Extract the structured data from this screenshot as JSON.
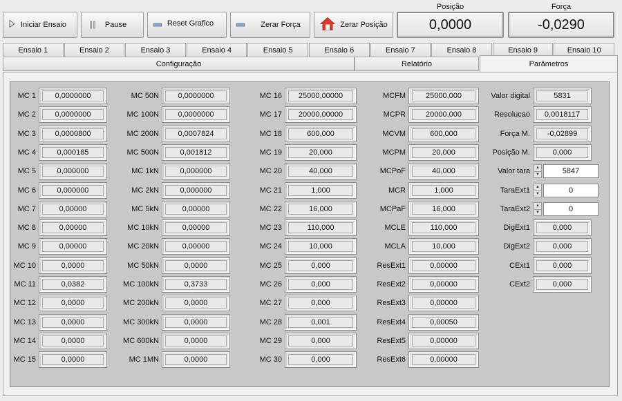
{
  "toolbar": {
    "iniciar_label": "Iniciar Ensaio",
    "pause_label": "Pause",
    "reset_label": "Reset Grafico",
    "zerar_forca_label": "Zerar Força",
    "zerar_posicao_label": "Zerar Posição"
  },
  "readouts": {
    "posicao_label": "Posição",
    "posicao_value": "0,0000",
    "forca_label": "Força",
    "forca_value": "-0,0290"
  },
  "ensaio_tabs": [
    "Ensaio 1",
    "Ensaio 2",
    "Ensaio 3",
    "Ensaio 4",
    "Ensaio 5",
    "Ensaio 6",
    "Ensaio 7",
    "Ensaio 8",
    "Ensaio 9",
    "Ensaio 10"
  ],
  "section_tabs": [
    "Configuração",
    "Relatório",
    "Parâmetros"
  ],
  "columns": {
    "col1": [
      {
        "label": "MC 1",
        "value": "0,0000000"
      },
      {
        "label": "MC 2",
        "value": "0,0000000"
      },
      {
        "label": "MC 3",
        "value": "0,0000800"
      },
      {
        "label": "MC 4",
        "value": "0,000185"
      },
      {
        "label": "MC 5",
        "value": "0,000000"
      },
      {
        "label": "MC 6",
        "value": "0,000000"
      },
      {
        "label": "MC 7",
        "value": "0,00000"
      },
      {
        "label": "MC 8",
        "value": "0,00000"
      },
      {
        "label": "MC 9",
        "value": "0,00000"
      },
      {
        "label": "MC 10",
        "value": "0,0000"
      },
      {
        "label": "MC 11",
        "value": "0,0382"
      },
      {
        "label": "MC 12",
        "value": "0,0000"
      },
      {
        "label": "MC 13",
        "value": "0,0000"
      },
      {
        "label": "MC 14",
        "value": "0,0000"
      },
      {
        "label": "MC 15",
        "value": "0,0000"
      }
    ],
    "col2": [
      {
        "label": "MC 50N",
        "value": "0,0000000"
      },
      {
        "label": "MC 100N",
        "value": "0,0000000"
      },
      {
        "label": "MC 200N",
        "value": "0,0007824"
      },
      {
        "label": "MC 500N",
        "value": "0,001812"
      },
      {
        "label": "MC 1kN",
        "value": "0,000000"
      },
      {
        "label": "MC 2kN",
        "value": "0,000000"
      },
      {
        "label": "MC 5kN",
        "value": "0,00000"
      },
      {
        "label": "MC 10kN",
        "value": "0,00000"
      },
      {
        "label": "MC 20kN",
        "value": "0,00000"
      },
      {
        "label": "MC 50kN",
        "value": "0,0000"
      },
      {
        "label": "MC 100kN",
        "value": "0,3733"
      },
      {
        "label": "MC 200kN",
        "value": "0,0000"
      },
      {
        "label": "MC 300kN",
        "value": "0,0000"
      },
      {
        "label": "MC 600kN",
        "value": "0,0000"
      },
      {
        "label": "MC 1MN",
        "value": "0,0000"
      }
    ],
    "col3": [
      {
        "label": "MC 16",
        "value": "25000,00000"
      },
      {
        "label": "MC 17",
        "value": "20000,00000"
      },
      {
        "label": "MC 18",
        "value": "600,000"
      },
      {
        "label": "MC 19",
        "value": "20,000"
      },
      {
        "label": "MC 20",
        "value": "40,000"
      },
      {
        "label": "MC 21",
        "value": "1,000"
      },
      {
        "label": "MC 22",
        "value": "16,000"
      },
      {
        "label": "MC 23",
        "value": "110,000"
      },
      {
        "label": "MC 24",
        "value": "10,000"
      },
      {
        "label": "MC 25",
        "value": "0,000"
      },
      {
        "label": "MC 26",
        "value": "0,000"
      },
      {
        "label": "MC 27",
        "value": "0,000"
      },
      {
        "label": "MC 28",
        "value": "0,001"
      },
      {
        "label": "MC 29",
        "value": "0,000"
      },
      {
        "label": "MC 30",
        "value": "0,000"
      }
    ],
    "col4": [
      {
        "label": "MCFM",
        "value": "25000,000"
      },
      {
        "label": "MCPR",
        "value": "20000,000"
      },
      {
        "label": "MCVM",
        "value": "600,000"
      },
      {
        "label": "MCPM",
        "value": "20,000"
      },
      {
        "label": "MCPoF",
        "value": "40,000"
      },
      {
        "label": "MCR",
        "value": "1,000"
      },
      {
        "label": "MCPaF",
        "value": "16,000"
      },
      {
        "label": "MCLE",
        "value": "110,000"
      },
      {
        "label": "MCLA",
        "value": "10,000"
      },
      {
        "label": "ResExt1",
        "value": "0,00000"
      },
      {
        "label": "ResExt2",
        "value": "0,00000"
      },
      {
        "label": "ResExt3",
        "value": "0,00000"
      },
      {
        "label": "ResExt4",
        "value": "0,00050"
      },
      {
        "label": "ResExt5",
        "value": "0,00000"
      },
      {
        "label": "ResExt6",
        "value": "0,00000"
      }
    ],
    "col5": [
      {
        "label": "Valor digital",
        "value": "5831",
        "kind": "ro"
      },
      {
        "label": "Resolucao",
        "value": "0,0018117",
        "kind": "ro"
      },
      {
        "label": "Força M.",
        "value": "-0,02899",
        "kind": "ro"
      },
      {
        "label": "Posição M.",
        "value": "0,000",
        "kind": "ro"
      },
      {
        "label": "Valor tara",
        "value": "5847",
        "kind": "spin"
      },
      {
        "label": "TaraExt1",
        "value": "0",
        "kind": "spin"
      },
      {
        "label": "TaraExt2",
        "value": "0",
        "kind": "spin"
      },
      {
        "label": "DigExt1",
        "value": "0,000",
        "kind": "ro"
      },
      {
        "label": "DigExt2",
        "value": "0,000",
        "kind": "ro"
      },
      {
        "label": "CExt1",
        "value": "0,000",
        "kind": "ro"
      },
      {
        "label": "CExt2",
        "value": "0,000",
        "kind": "ro"
      }
    ]
  }
}
